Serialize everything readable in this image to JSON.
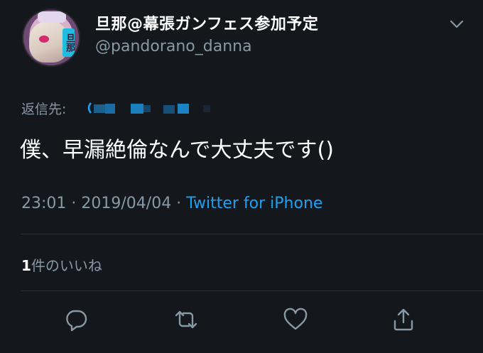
{
  "author": {
    "display_name": "旦那@幕張ガンフェス参加予定",
    "handle": "@pandorano_danna",
    "avatar_tag": "旦那"
  },
  "reply": {
    "label": "返信先:"
  },
  "tweet": {
    "text": "僕、早漏絶倫なんで大丈夫です()"
  },
  "meta": {
    "time": "23:01",
    "separator1": " · ",
    "date": "2019/04/04",
    "separator2": " · ",
    "source": "Twitter for iPhone"
  },
  "likes": {
    "count": "1",
    "label": "件のいいね"
  },
  "actions": {
    "icons": [
      "reply-icon",
      "retweet-icon",
      "like-icon",
      "share-icon"
    ]
  },
  "colors": {
    "background": "#14171c",
    "secondary_text": "#8899a6",
    "link": "#1da1f2",
    "divider": "#2f3336"
  }
}
